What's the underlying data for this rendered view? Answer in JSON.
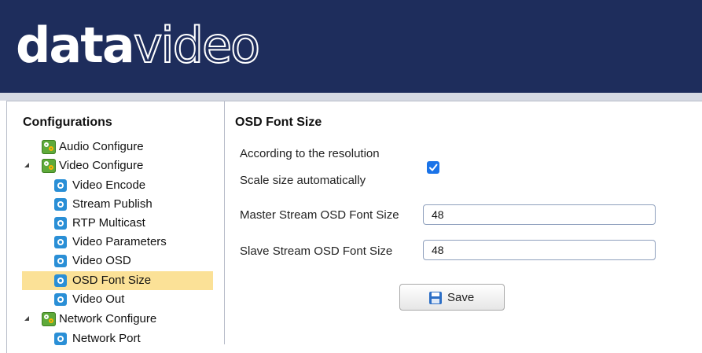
{
  "header": {
    "logo_bold": "data",
    "logo_thin": "video",
    "background_color": "#1e2d5c"
  },
  "sidebar": {
    "title": "Configurations",
    "items": [
      {
        "label": "Audio Configure",
        "icon": "gear-icon",
        "level": 0,
        "expandable": false,
        "selected": false
      },
      {
        "label": "Video Configure",
        "icon": "gear-icon",
        "level": 0,
        "expandable": true,
        "selected": false
      },
      {
        "label": "Video Encode",
        "icon": "settings-icon",
        "level": 1,
        "expandable": false,
        "selected": false
      },
      {
        "label": "Stream Publish",
        "icon": "settings-icon",
        "level": 1,
        "expandable": false,
        "selected": false
      },
      {
        "label": "RTP Multicast",
        "icon": "settings-icon",
        "level": 1,
        "expandable": false,
        "selected": false
      },
      {
        "label": "Video Parameters",
        "icon": "settings-icon",
        "level": 1,
        "expandable": false,
        "selected": false
      },
      {
        "label": "Video OSD",
        "icon": "settings-icon",
        "level": 1,
        "expandable": false,
        "selected": false
      },
      {
        "label": "OSD Font Size",
        "icon": "settings-icon",
        "level": 1,
        "expandable": false,
        "selected": true
      },
      {
        "label": "Video Out",
        "icon": "settings-icon",
        "level": 1,
        "expandable": false,
        "selected": false
      },
      {
        "label": "Network Configure",
        "icon": "gear-icon",
        "level": 0,
        "expandable": true,
        "selected": false
      },
      {
        "label": "Network Port",
        "icon": "settings-icon",
        "level": 1,
        "expandable": false,
        "selected": false
      }
    ],
    "selected_color": "#fbe197"
  },
  "content": {
    "title": "OSD Font Size",
    "auto_scale": {
      "label_line1": "According to the resolution",
      "label_line2": "Scale size automatically",
      "checked": true
    },
    "master_font_size": {
      "label": "Master Stream OSD Font Size",
      "value": "48"
    },
    "slave_font_size": {
      "label": "Slave Stream OSD Font Size",
      "value": "48"
    },
    "save_label": "Save"
  }
}
